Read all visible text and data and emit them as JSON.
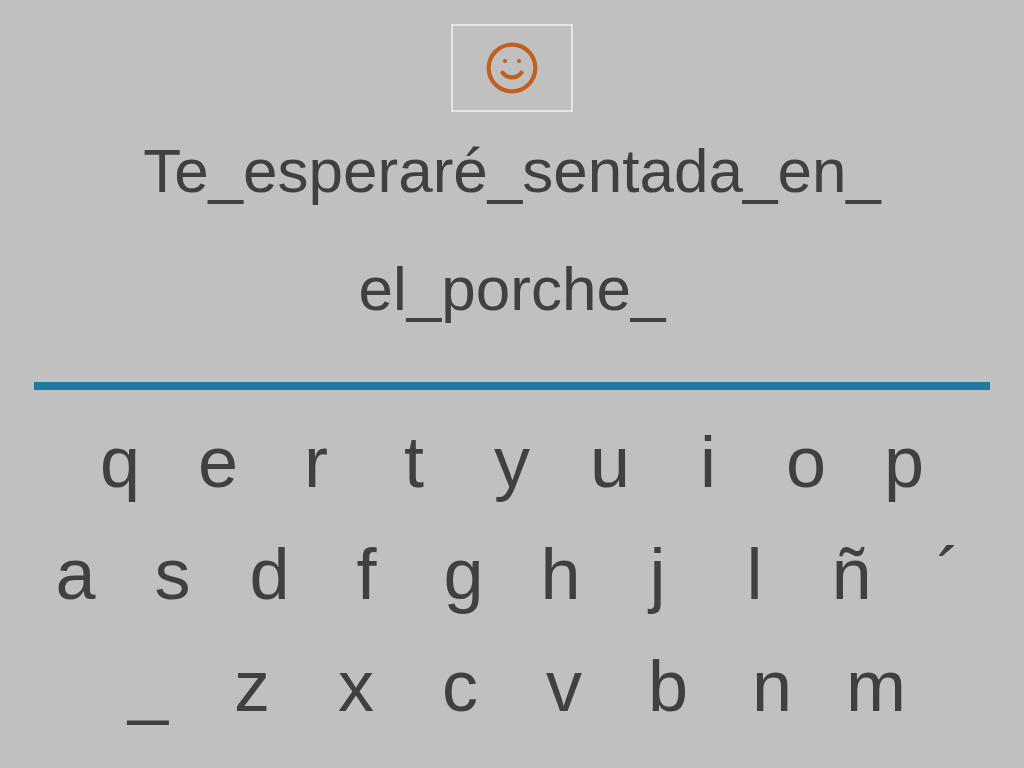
{
  "phrase_lines": [
    "Te_esperaré_sentada_en_",
    "el_porche_"
  ],
  "keyboard_rows": [
    [
      "q",
      "e",
      "r",
      "t",
      "y",
      "u",
      "i",
      "o",
      "p"
    ],
    [
      "a",
      "s",
      "d",
      "f",
      "g",
      "h",
      "j",
      "l",
      "ñ",
      "´"
    ],
    [
      "_",
      "z",
      "x",
      "c",
      "v",
      "b",
      "n",
      "m"
    ]
  ]
}
